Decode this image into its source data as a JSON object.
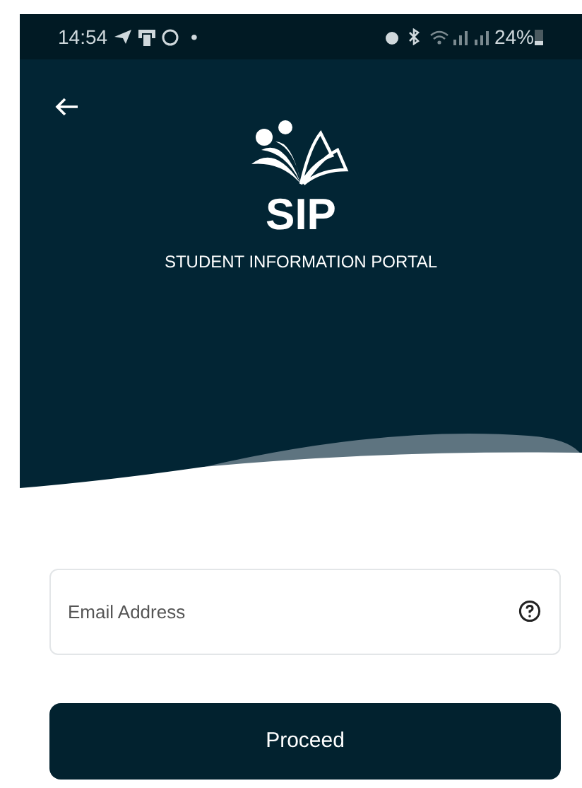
{
  "status_bar": {
    "time": "14:54",
    "dot": "•",
    "battery": "24%"
  },
  "header": {
    "logo_text": "SIP",
    "subtitle": "STUDENT INFORMATION PORTAL"
  },
  "email_field": {
    "placeholder": "Email Address"
  },
  "button": {
    "label": "Proceed"
  }
}
